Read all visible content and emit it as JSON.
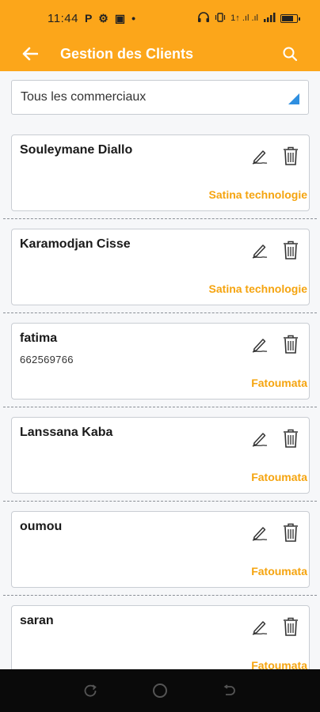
{
  "status_bar": {
    "time": "11:44",
    "left_glyphs": [
      "P",
      "⚙",
      "▣",
      "•"
    ],
    "right_text": "1↑ .ıl .ıl",
    "battery_level": 0.8,
    "icons": [
      "headset-icon",
      "vibrate-icon",
      "signal-icon",
      "battery-icon"
    ]
  },
  "app_bar": {
    "title": "Gestion des Clients",
    "back_icon": "arrow-left-icon",
    "search_icon": "search-icon",
    "color": "#fca61a"
  },
  "filter": {
    "selected": "Tous les commerciaux",
    "arrow_color": "#2f8fe0"
  },
  "clients": [
    {
      "name": "Souleymane Diallo",
      "phone": "",
      "salesperson": "Satina technologie"
    },
    {
      "name": "Karamodjan Cisse",
      "phone": "",
      "salesperson": "Satina technologie"
    },
    {
      "name": "fatima",
      "phone": "662569766",
      "salesperson": "Fatoumata"
    },
    {
      "name": "Lanssana Kaba",
      "phone": "",
      "salesperson": "Fatoumata"
    },
    {
      "name": "oumou",
      "phone": "",
      "salesperson": "Fatoumata"
    },
    {
      "name": "saran",
      "phone": "",
      "salesperson": "Fatoumata"
    }
  ],
  "colors": {
    "accent": "#fca61a",
    "salesperson_text": "#f5a40f"
  },
  "nav_bar": {
    "icons": [
      "recent-apps-icon",
      "home-icon",
      "back-icon"
    ]
  }
}
